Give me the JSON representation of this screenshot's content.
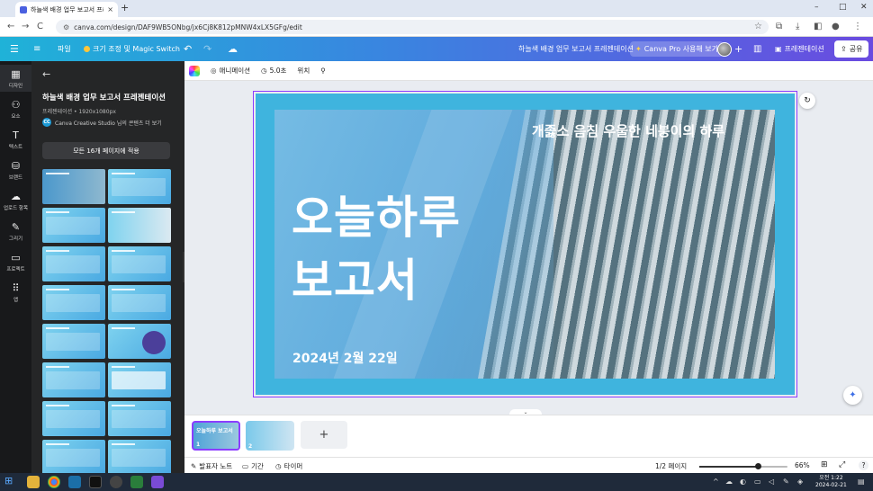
{
  "browser": {
    "tab_title": "하늘색 배경 업무 보고서 프리젠",
    "tab_close": "×",
    "new_tab": "+",
    "url": "canva.com/design/DAF9WB5ONbg/jx6Cj8K812pMNW4xLX5GFg/edit",
    "url_site_icon": "⚙",
    "nav": {
      "back": "←",
      "forward": "→",
      "reload": "C"
    },
    "window": {
      "minimize": "–",
      "maximize": "□",
      "close": "✕"
    }
  },
  "header": {
    "menu_icon": "☰",
    "file_label": "파일",
    "resize_label": "크기 조정 및 Magic Switch",
    "undo_icon": "↶",
    "redo_icon": "↷",
    "cloud_icon": "☁",
    "doc_title": "하늘색 배경 업무 보고서 프레젠테이션",
    "pro_label": "Canva Pro 사용해 보기",
    "add_icon": "+",
    "stats_icon": "▥",
    "present_label": "프레젠테이션",
    "share_label": "공유"
  },
  "rail": {
    "items": [
      {
        "icon": "▦",
        "label": "디자인"
      },
      {
        "icon": "⚇",
        "label": "요소"
      },
      {
        "icon": "T",
        "label": "텍스트"
      },
      {
        "icon": "⛁",
        "label": "브랜드"
      },
      {
        "icon": "☁",
        "label": "업로드 항목"
      },
      {
        "icon": "✎",
        "label": "그리기"
      },
      {
        "icon": "▭",
        "label": "프로젝트"
      },
      {
        "icon": "⠿",
        "label": "앱"
      }
    ]
  },
  "panel": {
    "back_icon": "←",
    "title": "하늘색 배경 업무 보고서 프레젠테이션",
    "subtitle": "프레젠테이션 • 1920x1080px",
    "author_badge": "CC",
    "author": "Canva Creative Studio 님의 콘텐츠 더 보기",
    "apply_button": "모든 16개 페이지에 적용",
    "collapse_icon": "‹"
  },
  "toolbar": {
    "animation_label": "애니메이션",
    "duration_label": "5.0초",
    "position_label": "위치",
    "paint_icon": "⚲"
  },
  "slide": {
    "subtitle": "개졿소 음침 우울한 네붕이의 하루",
    "title_line1": "오늘하루",
    "title_line2": "보고서",
    "date": "2024년 2월 22일"
  },
  "canvas": {
    "regen_icon": "↻",
    "magic_icon": "✦",
    "chevron": "⌄"
  },
  "filmstrip": {
    "page1_title": "오늘하루 보고서",
    "page1_num": "1",
    "page2_num": "2",
    "add_page": "+"
  },
  "footer": {
    "notes_label": "발표자 노트",
    "duration_label": "기간",
    "timer_label": "타이머",
    "page_indicator": "1/2 페이지",
    "zoom_value": 0.66,
    "zoom_label": "66%",
    "grid_icon": "⊞",
    "fullscreen_icon": "⤢",
    "help_icon": "?"
  },
  "taskbar": {
    "time": "오전 1:22",
    "date": "2024-02-21",
    "start_icon": "⊞"
  },
  "colors": {
    "accent": "#8b3dff",
    "header_start": "#1fb2d8",
    "header_end": "#6a4be0",
    "slide_bg": "#3fb4de"
  }
}
